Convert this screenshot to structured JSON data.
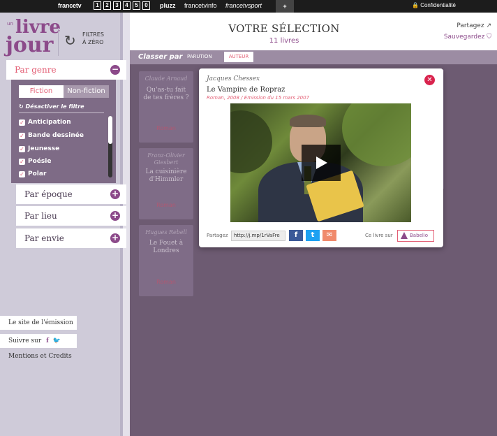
{
  "topbar": {
    "brand": "francetv",
    "channels": [
      "1",
      "2",
      "3",
      "4",
      "5",
      "0"
    ],
    "pluzz": "pluzz",
    "tvinfo": "francetvinfo",
    "tvsport": "francetvsport",
    "plus": "+",
    "privacy": "Confidentialité"
  },
  "logo": {
    "un": "un",
    "livre": "livre",
    "jour": "jour"
  },
  "reset": {
    "label_1": "FILTRES",
    "label_2": "À ZÉRO"
  },
  "filters": {
    "genre": {
      "label": "Par genre",
      "toggle": "−",
      "tabs": {
        "active": "Fiction",
        "inactive": "Non-fiction"
      },
      "deactivate": "Désactiver le filtre",
      "options": [
        "Anticipation",
        "Bande dessinée",
        "Jeunesse",
        "Poésie",
        "Polar"
      ]
    },
    "epoque": {
      "label": "Par époque",
      "toggle": "+"
    },
    "lieu": {
      "label": "Par lieu",
      "toggle": "+"
    },
    "envie": {
      "label": "Par envie",
      "toggle": "+"
    }
  },
  "sidebar_links": {
    "site": "Le site de l'émission",
    "follow": "Suivre sur",
    "mentions": "Mentions et Credits"
  },
  "header": {
    "title": "VOTRE SÉLECTION",
    "count": "11 livres",
    "share": "Partagez",
    "save": "Sauvegardez"
  },
  "sort": {
    "label": "Classer par",
    "options": [
      "PARUTION",
      "AUTEUR"
    ],
    "active": "AUTEUR"
  },
  "books": [
    {
      "author": "Claude Arnaud",
      "title": "Qu'as-tu fait de tes frères ?",
      "genre": "Roman"
    },
    {
      "author": "Franz-Olivier Giesbert",
      "title": "La cuisinière d'Himmler",
      "genre": "Roman"
    },
    {
      "author": "Hugues Rebell",
      "title": "Le Fouet à Londres",
      "genre": "Roman"
    }
  ],
  "modal": {
    "author": "Jacques Chessex",
    "title": "Le Vampire de Ropraz",
    "meta": "Roman, 2008 / Emission du 15 mars 2007",
    "share_label": "Partagez",
    "share_url": "http://j.mp/1rVaFre",
    "buy_label": "Ce livre sur",
    "buy_site": "Babelio"
  },
  "colors": {
    "accent": "#8c4a8a",
    "pink": "#e35f75",
    "close": "#d9234d",
    "facebook": "#3b5998",
    "twitter": "#1da1f2",
    "mail": "#f08a6c"
  }
}
